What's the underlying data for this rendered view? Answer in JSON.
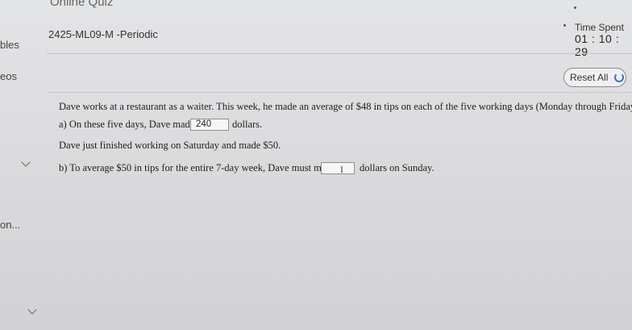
{
  "header": {
    "app_title": "Online Quiz",
    "course": "2425-ML09-M -Periodic",
    "time_label": "Time Spent",
    "time_value": "01 : 10 : 29"
  },
  "sidebar": {
    "items": [
      "bles",
      "eos",
      "on..."
    ]
  },
  "toolbar": {
    "reset_label": "Reset All"
  },
  "question": {
    "intro": "Dave works at a restaurant as a waiter. This week, he made an average of $48 in tips on each of the five working days (Monday through Friday).",
    "part_a_prefix": "a) On these five days, Dave made",
    "part_a_value": "240",
    "part_a_suffix": "dollars.",
    "middle": "Dave just finished working on Saturday and made $50.",
    "part_b_prefix": "b) To average $50 in tips for the entire 7-day week, Dave must make",
    "part_b_value": "",
    "part_b_suffix": "dollars on Sunday."
  }
}
